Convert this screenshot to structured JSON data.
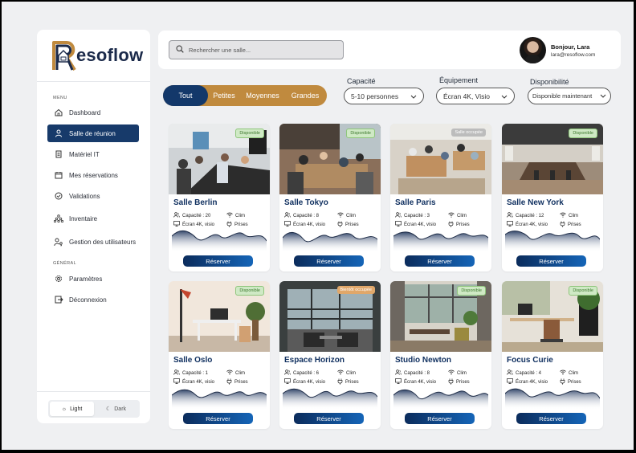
{
  "app": {
    "name": "Resoflow",
    "logo_text": "esoflow"
  },
  "sidebar": {
    "menu_label": "MENU",
    "general_label": "GÉNÉRAL",
    "items": [
      {
        "label": "Dashboard",
        "icon": "home-icon",
        "active": false
      },
      {
        "label": "Salle de réunion",
        "icon": "user-icon",
        "active": true
      },
      {
        "label": "Matériel IT",
        "icon": "document-icon",
        "active": false
      },
      {
        "label": "Mes réservations",
        "icon": "calendar-icon",
        "active": false
      },
      {
        "label": "Validations",
        "icon": "check-circle-icon",
        "active": false
      },
      {
        "label": "Inventaire",
        "icon": "boxes-icon",
        "active": false
      },
      {
        "label": "Gestion des utilisateurs",
        "icon": "user-key-icon",
        "active": false
      }
    ],
    "general_items": [
      {
        "label": "Paramètres",
        "icon": "gear-icon"
      },
      {
        "label": "Déconnexion",
        "icon": "logout-icon"
      }
    ],
    "theme": {
      "light": "Light",
      "dark": "Dark",
      "selected": "Light"
    }
  },
  "header": {
    "search_placeholder": "Rechercher une salle...",
    "greeting": "Bonjour, Lara",
    "email": "lara@resoflow.com"
  },
  "filters": {
    "size_tabs": [
      "Tout",
      "Petites",
      "Moyennes",
      "Grandes"
    ],
    "size_selected": "Tout",
    "capacity_label": "Capacité",
    "capacity_value": "5-10 personnes",
    "equipment_label": "Équipement",
    "equipment_value": "Écran 4K, Visio",
    "availability_label": "Disponibilité",
    "availability_value": "Disponible maintenant"
  },
  "colors": {
    "primary": "#13386a",
    "accent": "#c08a3e",
    "available": "#8fc67c",
    "soon": "#e0a76a"
  },
  "reserve_label": "Réserver",
  "rooms": [
    {
      "name": "Salle Berlin",
      "capacity": "Capacité : 20",
      "screen": "Écran 4K, visio",
      "clim": "Clim",
      "plugs": "Prises",
      "status": "Disponible",
      "status_type": "green"
    },
    {
      "name": "Salle Tokyo",
      "capacity": "Capacité : 8",
      "screen": "Écran 4K, visio",
      "clim": "Clim",
      "plugs": "Prises",
      "status": "Disponible",
      "status_type": "green"
    },
    {
      "name": "Salle Paris",
      "capacity": "Capacité : 3",
      "screen": "Écran 4K, visio",
      "clim": "Clim",
      "plugs": "Prises",
      "status": "Salle occupée",
      "status_type": "gray"
    },
    {
      "name": "Salle New York",
      "capacity": "Capacité : 12",
      "screen": "Écran 4K, visio",
      "clim": "Clim",
      "plugs": "Prises",
      "status": "Disponible",
      "status_type": "green"
    },
    {
      "name": "Salle Oslo",
      "capacity": "Capacité : 1",
      "screen": "Écran 4K, visio",
      "clim": "Clim",
      "plugs": "Prises",
      "status": "Disponible",
      "status_type": "green"
    },
    {
      "name": "Espace Horizon",
      "capacity": "Capacité : 6",
      "screen": "Écran 4K, visio",
      "clim": "Clim",
      "plugs": "Prises",
      "status": "Bientôt occupée",
      "status_type": "orange"
    },
    {
      "name": "Studio Newton",
      "capacity": "Capacité : 8",
      "screen": "Écran 4K, visio",
      "clim": "Clim",
      "plugs": "Prises",
      "status": "Disponible",
      "status_type": "green"
    },
    {
      "name": "Focus Curie",
      "capacity": "Capacité : 4",
      "screen": "Écran 4K, visio",
      "clim": "Clim",
      "plugs": "Prises",
      "status": "Disponible",
      "status_type": "green"
    }
  ]
}
